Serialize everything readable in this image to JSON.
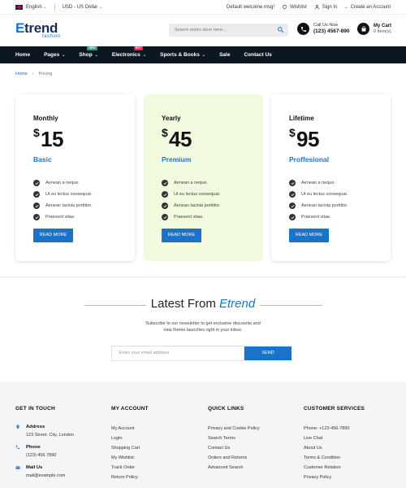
{
  "topbar": {
    "language": "English",
    "currency": "USD - US Dollar",
    "welcome": "Default welcome msg!",
    "wishlist": "Wishlist",
    "signin": "Sign In",
    "create_account": "Create an Account"
  },
  "header": {
    "logo_main_accent": "E",
    "logo_main_rest": "trend",
    "logo_sub": "fashion",
    "search_placeholder": "Search entire store here...",
    "call_label": "Call Us Now",
    "call_number": "(123) 4567-890",
    "cart_label": "My Cart",
    "cart_count": "0 Item(s)"
  },
  "nav": {
    "items": [
      {
        "label": "Home"
      },
      {
        "label": "Pages"
      },
      {
        "label": "Shop",
        "badge": "NEW"
      },
      {
        "label": "Electronics",
        "badge": "HOT"
      },
      {
        "label": "Sports & Books"
      },
      {
        "label": "Sale"
      },
      {
        "label": "Contact Us"
      }
    ]
  },
  "breadcrumb": {
    "home": "Home",
    "current": "Pricing"
  },
  "plans": [
    {
      "name": "Monthly",
      "currency": "$",
      "price": "15",
      "tier": "Basic",
      "features": [
        "Aenean a neque.",
        "Ut eu lectus consequat.",
        "Aenean lacinia porttitor.",
        "Praesent vitae."
      ],
      "button": "READ MORE"
    },
    {
      "name": "Yearly",
      "currency": "$",
      "price": "45",
      "tier": "Premium",
      "features": [
        "Aenean a neque.",
        "Ut eu lectus consequat.",
        "Aenean lacinia porttitor.",
        "Praesent vitae."
      ],
      "button": "READ MORE"
    },
    {
      "name": "Lifetime",
      "currency": "$",
      "price": "95",
      "tier": "Proffesional",
      "features": [
        "Aenean a neque.",
        "Ut eu lectus consequat.",
        "Aenean lacinia porttitor.",
        "Praesent vitae."
      ],
      "button": "READ MORE"
    }
  ],
  "newsletter": {
    "title_prefix": "Latest From",
    "title_brand": "Etrend",
    "text_line1": "Subscribe to our newsletter to get exclusive discounts and",
    "text_line2": "new theme launches right in your inbox.",
    "email_placeholder": "Enter your email address",
    "send": "SEND"
  },
  "footer": {
    "get_in_touch": {
      "title": "GET IN TOUCH",
      "address_label": "Address",
      "address_value": "123 Street, City, London",
      "phone_label": "Phone",
      "phone_value": "(123) 456 7890",
      "mail_label": "Mail Us",
      "mail_value": "mail@example.com"
    },
    "my_account": {
      "title": "MY ACCOUNT",
      "links": [
        "My Account",
        "Login",
        "Shopping Cart",
        "My Wishlist",
        "Track Order",
        "Return Policy"
      ]
    },
    "quick_links": {
      "title": "QUICK LINKS",
      "links": [
        "Privacy and Cookie Policy",
        "Search Terms",
        "Contact Us",
        "Orders and Returns",
        "Advanced Search"
      ]
    },
    "customer_service": {
      "title": "CUSTOMER SERVICES",
      "links": [
        "Phone: +123-456-7890",
        "Live Chat",
        "About Us",
        "Terms & Condition",
        "Customer Relation",
        "Privacy Policy"
      ]
    }
  },
  "colors": {
    "accent": "#1a73c9",
    "nav_bg": "#0c1724",
    "highlight_card": "#f1fadf",
    "footer_bg": "#f4f5f7"
  }
}
